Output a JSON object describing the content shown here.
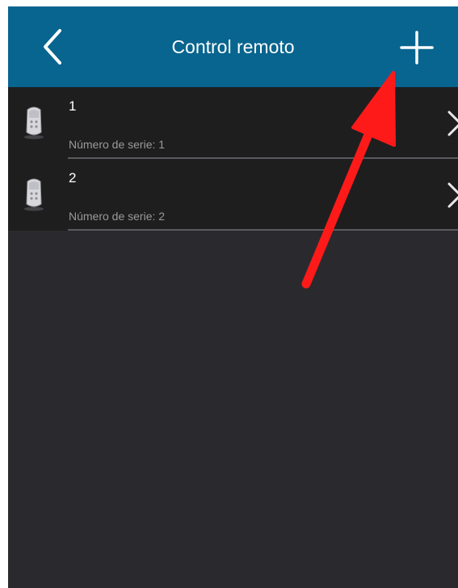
{
  "header": {
    "title": "Control remoto",
    "back_icon": "chevron-left-icon",
    "add_icon": "plus-icon",
    "background": "#07658f"
  },
  "remotes": [
    {
      "name": "1",
      "serial": "Número de serie: 1",
      "icon": "remote-control-icon"
    },
    {
      "name": "2",
      "serial": "Número de serie: 2",
      "icon": "remote-control-icon"
    }
  ],
  "colors": {
    "list_background": "#2a2a2e",
    "row_background": "#1e1e1f",
    "annotation_arrow": "#ff1a1a"
  }
}
